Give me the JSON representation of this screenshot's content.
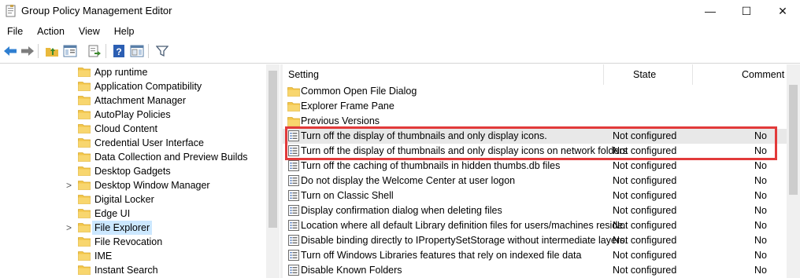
{
  "window": {
    "title": "Group Policy Management Editor",
    "min_glyph": "—",
    "max_glyph": "☐",
    "close_glyph": "✕"
  },
  "menu": [
    "File",
    "Action",
    "View",
    "Help"
  ],
  "toolbar_icons": [
    "back-arrow-icon",
    "forward-arrow-icon",
    "up-folder-icon",
    "show-hide-tree-icon",
    "export-list-icon",
    "help-icon",
    "properties-pane-icon",
    "filter-icon"
  ],
  "tree": {
    "items": [
      {
        "label": "App runtime",
        "chevron": ""
      },
      {
        "label": "Application Compatibility",
        "chevron": ""
      },
      {
        "label": "Attachment Manager",
        "chevron": ""
      },
      {
        "label": "AutoPlay Policies",
        "chevron": ""
      },
      {
        "label": "Cloud Content",
        "chevron": ""
      },
      {
        "label": "Credential User Interface",
        "chevron": ""
      },
      {
        "label": "Data Collection and Preview Builds",
        "chevron": ""
      },
      {
        "label": "Desktop Gadgets",
        "chevron": ""
      },
      {
        "label": "Desktop Window Manager",
        "chevron": ">"
      },
      {
        "label": "Digital Locker",
        "chevron": ""
      },
      {
        "label": "Edge UI",
        "chevron": ""
      },
      {
        "label": "File Explorer",
        "chevron": ">",
        "selected": true
      },
      {
        "label": "File Revocation",
        "chevron": ""
      },
      {
        "label": "IME",
        "chevron": ""
      },
      {
        "label": "Instant Search",
        "chevron": ""
      }
    ]
  },
  "list": {
    "headers": {
      "setting": "Setting",
      "state": "State",
      "comment": "Comment"
    },
    "rows": [
      {
        "type": "folder",
        "setting": "Common Open File Dialog",
        "state": "",
        "comment": ""
      },
      {
        "type": "folder",
        "setting": "Explorer Frame Pane",
        "state": "",
        "comment": ""
      },
      {
        "type": "folder",
        "setting": "Previous Versions",
        "state": "",
        "comment": ""
      },
      {
        "type": "policy",
        "setting": "Turn off the display of thumbnails and only display icons.",
        "state": "Not configured",
        "comment": "No",
        "highlighted": true
      },
      {
        "type": "policy",
        "setting": "Turn off the display of thumbnails and only display icons on network folders",
        "state": "Not configured",
        "comment": "No"
      },
      {
        "type": "policy",
        "setting": "Turn off the caching of thumbnails in hidden thumbs.db files",
        "state": "Not configured",
        "comment": "No"
      },
      {
        "type": "policy",
        "setting": "Do not display the Welcome Center at user logon",
        "state": "Not configured",
        "comment": "No"
      },
      {
        "type": "policy",
        "setting": "Turn on Classic Shell",
        "state": "Not configured",
        "comment": "No"
      },
      {
        "type": "policy",
        "setting": "Display confirmation dialog when deleting files",
        "state": "Not configured",
        "comment": "No"
      },
      {
        "type": "policy",
        "setting": "Location where all default Library definition files for users/machines reside.",
        "state": "Not configured",
        "comment": "No"
      },
      {
        "type": "policy",
        "setting": "Disable binding directly to IPropertySetStorage without intermediate layers.",
        "state": "Not configured",
        "comment": "No"
      },
      {
        "type": "policy",
        "setting": "Turn off Windows Libraries features that rely on indexed file data",
        "state": "Not configured",
        "comment": "No"
      },
      {
        "type": "policy",
        "setting": "Disable Known Folders",
        "state": "Not configured",
        "comment": "No"
      }
    ]
  },
  "colors": {
    "annotation": "#e23a3a",
    "selection": "#cce8ff",
    "folder": "#f3c64a"
  }
}
